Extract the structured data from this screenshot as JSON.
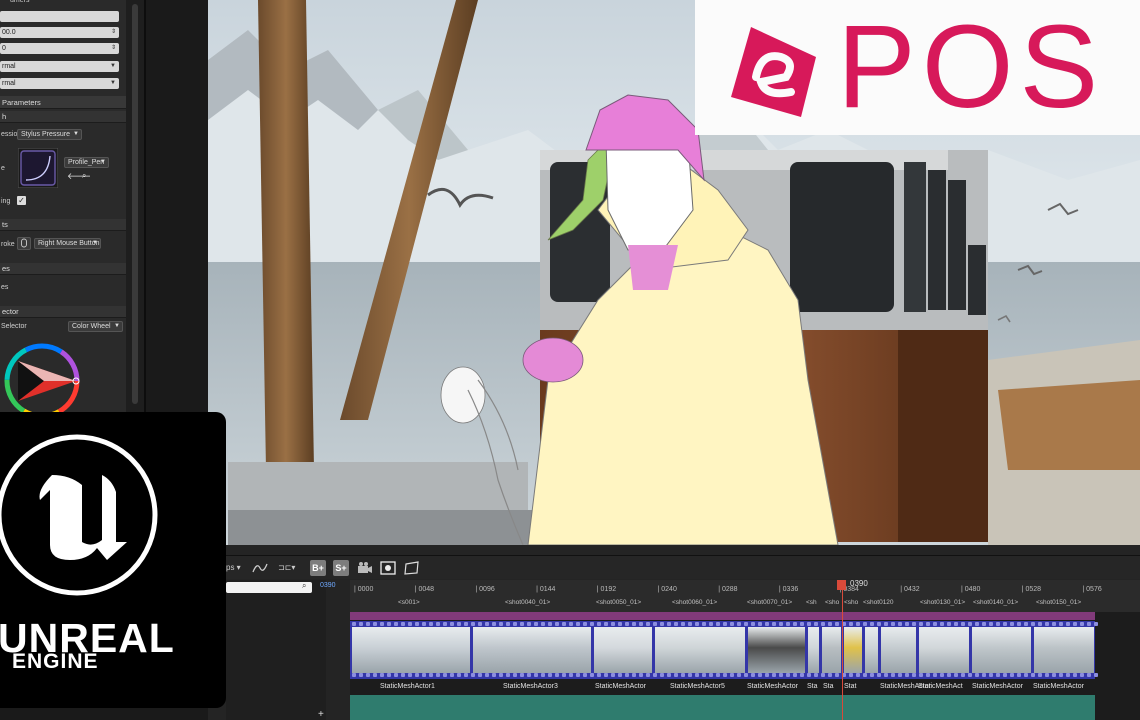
{
  "details": {
    "top_label": "umers",
    "fields": [
      "",
      "00.0",
      "0"
    ],
    "blend_modes": [
      "rmal",
      "rmal"
    ],
    "section_parameters": "Parameters",
    "sub_brush": "h",
    "pressure_label": "ession",
    "pressure_value": "Stylus Pressure",
    "profile_label": "e",
    "profile_value": "Profile_Pen",
    "smoothing_label": "ing",
    "sub_shortcuts": "ts",
    "stroke_label": "roke",
    "stroke_value": "Right Mouse Button",
    "sub_es": "es",
    "es_label": "es",
    "sub_selector": "ector",
    "selector_label": "Selector",
    "selector_value": "Color Wheel"
  },
  "ue_logo": {
    "word1": "UNREAL",
    "word2": "ENGINE"
  },
  "epos_logo": {
    "wordmark": "POS"
  },
  "sequencer": {
    "toolbar": {
      "snap_label": "ps",
      "badge_b": "B+",
      "badge_s": "S+"
    },
    "outliner_frame": "0390",
    "playhead_frame": "0390",
    "ruler_ticks": [
      "0000",
      "0048",
      "0096",
      "0144",
      "0192",
      "0240",
      "0288",
      "0336",
      "0384",
      "0432",
      "0480",
      "0528",
      "0576"
    ],
    "shots": [
      "<s001>",
      "<shot0040_01>",
      "<shot0050_01>",
      "<shot0060_01>",
      "<shot0070_01>",
      "<sh",
      "<sho",
      "<sho",
      "<shot0120",
      "<shot0130_01>",
      "<shot0140_01>",
      "<shot0150_01>"
    ],
    "clips": [
      "StaticMeshActor1",
      "StaticMeshActor3",
      "StaticMeshActor",
      "StaticMeshActor5",
      "StaticMeshActor",
      "Sta",
      "Sta",
      "Stat",
      "StaticMeshActor",
      "StaticMeshAct",
      "StaticMeshActor",
      "StaticMeshActor"
    ]
  },
  "colors": {
    "epos_brand": "#d7195a",
    "shot_track": "#813a7a",
    "film_track": "#3436a8",
    "green_track": "#2f7c6e",
    "playhead": "#d94a3a"
  }
}
